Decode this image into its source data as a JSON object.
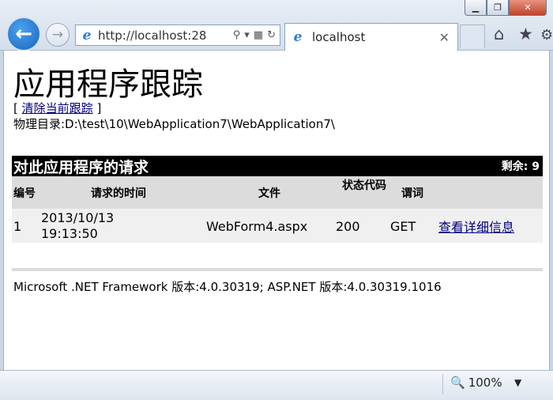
{
  "browser": {
    "address": "http://localhost:28",
    "tab_title": "localhost",
    "tab_close": "✕",
    "zoom": "100%"
  },
  "page": {
    "title": "应用程序跟踪",
    "clear_prefix": "[",
    "clear_link": "清除当前跟踪",
    "clear_suffix": "]",
    "physical_dir": "物理目录:D:\\test\\10\\WebApplication7\\WebApplication7\\",
    "requests_heading": "对此应用程序的请求",
    "remaining": "剩余: 9",
    "columns": {
      "no": "编号",
      "time": "请求的时间",
      "file": "文件",
      "status": "状态代码",
      "verb": "谓词"
    },
    "rows": [
      {
        "no": "1",
        "time": "2013/10/13 19:13:50",
        "file": "WebForm4.aspx",
        "status": "200",
        "verb": "GET",
        "details": "查看详细信息"
      }
    ],
    "footer": "Microsoft .NET Framework 版本:4.0.30319; ASP.NET 版本:4.0.30319.1016"
  }
}
